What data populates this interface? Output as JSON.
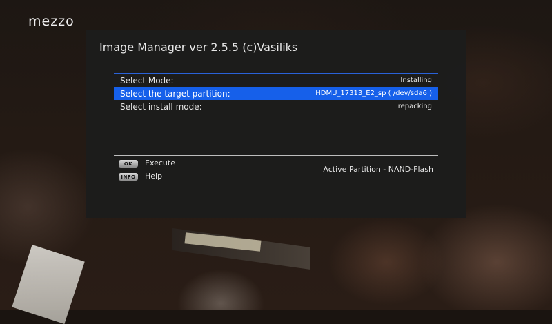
{
  "channel_logo": "mezzo",
  "dialog": {
    "title": "Image Manager ver 2.5.5 (c)Vasiliks",
    "rows": [
      {
        "label": "Select Mode:",
        "value": "Installing"
      },
      {
        "label": "Select the target partition:",
        "value": "HDMU_17313_E2_sp ( /dev/sda6 )"
      },
      {
        "label": "Select install mode:",
        "value": "repacking"
      }
    ],
    "selected_row": 1,
    "keys": [
      {
        "key": "OK",
        "label": "Execute"
      },
      {
        "key": "INFO",
        "label": "Help"
      }
    ],
    "status": "Active Partition  -  NAND-Flash"
  },
  "colors": {
    "selection": "#1660ea",
    "accent_line": "#2a62d8",
    "dialog_bg": "#1c1c1c"
  }
}
